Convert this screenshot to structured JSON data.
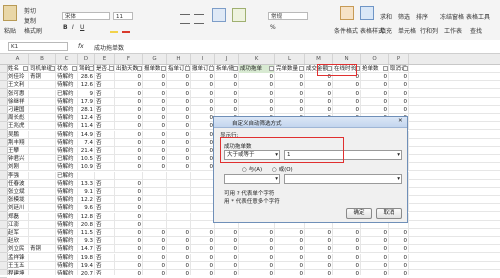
{
  "ribbon": {
    "font_name": "宋体",
    "font_size": "11",
    "number_format": "常规",
    "paste_label": "粘贴",
    "cut_label": "剪切",
    "copy_label": "复制",
    "format_painter_label": "格式刷",
    "condition_format_label": "条件格式",
    "table_style_label": "表格样式",
    "sum_label": "求和",
    "filter_label": "筛选",
    "sort_label": "排序",
    "fill_label": "填充",
    "cell_label": "单元格",
    "rowcol_label": "行和列",
    "worksheet_label": "工作表",
    "freeze_label": "冻结窗格",
    "tools_label": "表格工具",
    "find_label": "查找"
  },
  "formula_bar": {
    "name_box": "K1",
    "fx": "fx",
    "content": "成功拖单数"
  },
  "column_letters": [
    "A",
    "B",
    "C",
    "D",
    "E",
    "F",
    "G",
    "H",
    "I",
    "J",
    "K",
    "L",
    "M",
    "N",
    "O",
    "P"
  ],
  "header_row": [
    "姓名",
    "司机单组",
    "状态",
    "驾龄(年)",
    "是否上岗",
    "出勤天数",
    "报单数",
    "指单订单",
    "撤单订单",
    "拆单/撤",
    "成功拖单",
    "完单数量",
    "成交金额",
    "在线时长",
    "抢单数",
    "取消订单"
  ],
  "rows": [
    {
      "name": "刘佳玲",
      "group": "青铜",
      "status": "待解约",
      "age": "28.6",
      "onduty": "否",
      "v": [
        "0",
        "0",
        "0",
        "0",
        "0",
        "0",
        "0",
        "0",
        "0",
        "0",
        "0"
      ]
    },
    {
      "name": "王文利",
      "group": "",
      "status": "待解约",
      "age": "12.6",
      "onduty": "否",
      "v": [
        "0",
        "0",
        "0",
        "0",
        "0",
        "0",
        "0",
        "0",
        "0",
        "0",
        "0"
      ]
    },
    {
      "name": "张可惠",
      "group": "",
      "status": "已解约",
      "age": "9",
      "onduty": "否",
      "v": [
        "0",
        "0",
        "0",
        "0",
        "0",
        "0",
        "0",
        "0",
        "0",
        "0",
        "0"
      ]
    },
    {
      "name": "徐继祥",
      "group": "",
      "status": "待解约",
      "age": "17.9",
      "onduty": "否",
      "v": [
        "0",
        "0",
        "0",
        "0",
        "0",
        "0",
        "0",
        "0",
        "0",
        "0",
        "0"
      ]
    },
    {
      "name": "刁建国",
      "group": "",
      "status": "待解约",
      "age": "28.1",
      "onduty": "否",
      "v": [
        "0",
        "0",
        "0",
        "0",
        "0",
        "0",
        "0",
        "0",
        "0",
        "0",
        "0"
      ]
    },
    {
      "name": "周长彪",
      "group": "",
      "status": "待解约",
      "age": "12.4",
      "onduty": "否",
      "v": [
        "0",
        "0",
        "0",
        "0",
        "0",
        "0",
        "0",
        "0",
        "0",
        "0",
        "0"
      ]
    },
    {
      "name": "王兆虎",
      "group": "",
      "status": "待解约",
      "age": "11.4",
      "onduty": "否",
      "v": [
        "0",
        "0",
        "0",
        "0",
        "0",
        "0",
        "0",
        "0",
        "0",
        "0",
        "0"
      ]
    },
    {
      "name": "吴鹏",
      "group": "",
      "status": "待解约",
      "age": "14.9",
      "onduty": "否",
      "v": [
        "0",
        "0",
        "0",
        "0",
        "0",
        "0",
        "0",
        "0",
        "0",
        "0",
        "0"
      ]
    },
    {
      "name": "荆丰翔",
      "group": "",
      "status": "待解约",
      "age": "7.4",
      "onduty": "否",
      "v": [
        "0",
        "0",
        "0",
        "0",
        "0",
        "0",
        "0",
        "0",
        "0",
        "0",
        "0"
      ]
    },
    {
      "name": "王攀",
      "group": "",
      "status": "待解约",
      "age": "21.4",
      "onduty": "否",
      "v": [
        "0",
        "0",
        "0",
        "0",
        "0",
        "0",
        "0",
        "0",
        "0",
        "0",
        "0"
      ]
    },
    {
      "name": "钟君兴",
      "group": "",
      "status": "已解约",
      "age": "10.5",
      "onduty": "否",
      "v": [
        "0",
        "0",
        "0",
        "0",
        "0",
        "0",
        "0",
        "0",
        "0",
        "0",
        "0"
      ]
    },
    {
      "name": "刘刚",
      "group": "",
      "status": "待解约",
      "age": "10.9",
      "onduty": "否",
      "v": [
        "0",
        "0",
        "0",
        "0",
        "0",
        "0",
        "0",
        "0",
        "0",
        "0",
        "0"
      ]
    },
    {
      "name": "李强",
      "group": "",
      "status": "已解约",
      "age": "",
      "onduty": "",
      "v": [
        "",
        "",
        "",
        "",
        "",
        "",
        "",
        "",
        "",
        "",
        ""
      ]
    },
    {
      "name": "任春波",
      "group": "",
      "status": "待解约",
      "age": "13.3",
      "onduty": "否",
      "v": [
        "0",
        "",
        "",
        "",
        "",
        "",
        "",
        "",
        "",
        "",
        ""
      ]
    },
    {
      "name": "张立斌",
      "group": "",
      "status": "待解约",
      "age": "9.1",
      "onduty": "否",
      "v": [
        "0",
        "",
        "",
        "",
        "",
        "",
        "",
        "",
        "",
        "",
        ""
      ]
    },
    {
      "name": "张模垅",
      "group": "",
      "status": "待解约",
      "age": "12.2",
      "onduty": "否",
      "v": [
        "0",
        "",
        "",
        "",
        "",
        "",
        "",
        "",
        "",
        "",
        ""
      ]
    },
    {
      "name": "刘廷川",
      "group": "",
      "status": "待解约",
      "age": "9.6",
      "onduty": "否",
      "v": [
        "0",
        "",
        "",
        "",
        "",
        "",
        "",
        "",
        "",
        "",
        ""
      ]
    },
    {
      "name": "郑磊",
      "group": "",
      "status": "待解约",
      "age": "12.8",
      "onduty": "否",
      "v": [
        "0",
        "",
        "",
        "",
        "",
        "",
        "",
        "",
        "",
        "",
        ""
      ]
    },
    {
      "name": "江澎",
      "group": "",
      "status": "待解约",
      "age": "20.8",
      "onduty": "否",
      "v": [
        "0",
        "",
        "",
        "",
        "",
        "",
        "",
        "",
        "",
        "",
        ""
      ]
    },
    {
      "name": "赵军",
      "group": "",
      "status": "待解约",
      "age": "11.5",
      "onduty": "否",
      "v": [
        "0",
        "0",
        "0",
        "0",
        "0",
        "0",
        "0",
        "0",
        "0",
        "0",
        "0"
      ]
    },
    {
      "name": "赵欣",
      "group": "",
      "status": "待解约",
      "age": "9.3",
      "onduty": "否",
      "v": [
        "0",
        "0",
        "0",
        "0",
        "0",
        "0",
        "0",
        "0",
        "0",
        "0",
        "0"
      ]
    },
    {
      "name": "刘立民",
      "group": "青铜",
      "status": "待解约",
      "age": "14.7",
      "onduty": "否",
      "v": [
        "0",
        "0",
        "0",
        "0",
        "0",
        "0",
        "0",
        "0",
        "0",
        "0",
        "0"
      ]
    },
    {
      "name": "孟祥锋",
      "group": "",
      "status": "待解约",
      "age": "19.8",
      "onduty": "否",
      "v": [
        "0",
        "0",
        "0",
        "0",
        "0",
        "0",
        "0",
        "0",
        "0",
        "0",
        "0"
      ]
    },
    {
      "name": "王玉五",
      "group": "",
      "status": "待解约",
      "age": "19.4",
      "onduty": "否",
      "v": [
        "0",
        "0",
        "0",
        "0",
        "0",
        "0",
        "0",
        "0",
        "0",
        "0",
        "0"
      ]
    },
    {
      "name": "程建坤",
      "group": "",
      "status": "待解约",
      "age": "20.7",
      "onduty": "否",
      "v": [
        "0",
        "0",
        "0",
        "0",
        "0",
        "0",
        "0",
        "0",
        "0",
        "0",
        "0"
      ]
    }
  ],
  "dialog": {
    "title": "自定义自动筛选方式",
    "section_label": "显示行:",
    "field_label": "成功拖单数",
    "operator": "大于或等于",
    "value": "1",
    "radio_and": "与(A)",
    "radio_or": "或(O)",
    "hint1": "可用 ? 代表单个字符",
    "hint2": "用 * 代表任意多个字符",
    "ok": "确定",
    "cancel": "取消"
  }
}
